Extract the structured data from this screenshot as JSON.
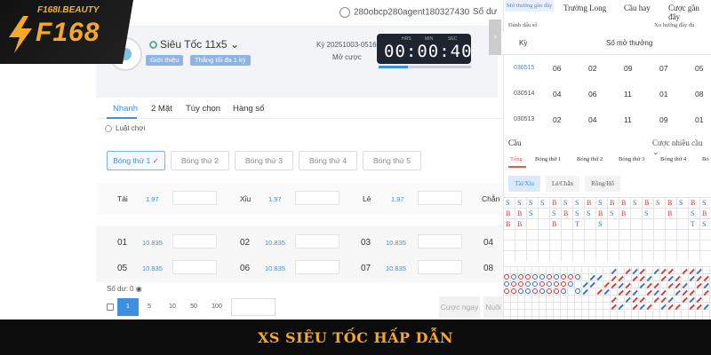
{
  "brand": {
    "domain": "F168I.BEAUTY",
    "name": "F168"
  },
  "header": {
    "account": "280obcp280agent180327430",
    "balance_label": "Số dư"
  },
  "game": {
    "title": "Siêu Tốc 11x5",
    "intro_label": "Giới thiệu",
    "limit_label": "Thắng tối đa 1 kỳ",
    "period": "Kỳ 20251003-0516",
    "status": "Mở cược",
    "timer_labels": [
      "HRS",
      "MIN",
      "SEC"
    ],
    "timer": "00:00:40",
    "timer_progress": 0.32
  },
  "main_tabs": [
    "Nhanh",
    "2 Mặt",
    "Tùy chọn",
    "Hàng số"
  ],
  "rules_link": "Luật chơi",
  "positions": [
    "Bóng thứ 1",
    "Bóng thứ 2",
    "Bóng thứ 3",
    "Bóng thứ 4",
    "Bóng thứ 5"
  ],
  "bets": [
    {
      "label": "Tài",
      "odd": "1.97"
    },
    {
      "label": "Xỉu",
      "odd": "1.97"
    },
    {
      "label": "Lẻ",
      "odd": "1.97"
    },
    {
      "label": "Chẵn",
      "odd": ""
    }
  ],
  "numbers": [
    {
      "num": "01",
      "odd": "10.835"
    },
    {
      "num": "02",
      "odd": "10.835"
    },
    {
      "num": "03",
      "odd": "10.835"
    },
    {
      "num": "04",
      "odd": ""
    },
    {
      "num": "05",
      "odd": "10.835"
    },
    {
      "num": "06",
      "odd": "10.835"
    },
    {
      "num": "07",
      "odd": "10.835"
    },
    {
      "num": "08",
      "odd": ""
    }
  ],
  "balance_row": {
    "label": "Số dư:",
    "value": "0"
  },
  "chips": [
    "1",
    "5",
    "10",
    "50",
    "100"
  ],
  "buttons": {
    "bet_now": "Cược ngay",
    "other": "Nuôi"
  },
  "right_tabs": [
    "Mở thưởng gần đây",
    "Trường Long",
    "Cầu hay",
    "Cược gần đây"
  ],
  "right_sub": {
    "left": "Đánh dấu số",
    "right": "Xu hướng đầy đủ"
  },
  "results_header": {
    "period": "Kỳ",
    "numbers": "Số mở thưởng"
  },
  "results": [
    {
      "period": "036515",
      "nums": [
        "06",
        "02",
        "09",
        "07",
        "05"
      ],
      "highlight": true
    },
    {
      "period": "030514",
      "nums": [
        "04",
        "06",
        "11",
        "01",
        "08"
      ],
      "highlight": false
    },
    {
      "period": "030513",
      "nums": [
        "02",
        "04",
        "11",
        "09",
        "01"
      ],
      "highlight": false
    }
  ],
  "cau": {
    "title": "Cầu",
    "more": "Cược nhiều cầu"
  },
  "cau_tabs": [
    "Tổng",
    "Bóng thứ 1",
    "Bóng thứ 2",
    "Bóng thứ 3",
    "Bóng thứ 4",
    "Bó"
  ],
  "cau_types": [
    "Tài/Xỉu",
    "Lẻ/Chẵn",
    "Rồng/Hổ"
  ],
  "road_cols": [
    [
      "S",
      "B",
      "B"
    ],
    [
      "S",
      "B",
      "B"
    ],
    [
      "S",
      "S",
      ""
    ],
    [
      "S",
      "",
      " "
    ],
    [
      "B",
      "S",
      "B"
    ],
    [
      "S",
      "B",
      ""
    ],
    [
      "S",
      "S",
      "T"
    ],
    [
      "B",
      "S",
      ""
    ],
    [
      "S",
      "B",
      "S"
    ],
    [
      "B",
      "S",
      ""
    ],
    [
      "B",
      "B",
      ""
    ],
    [
      "S",
      "",
      ""
    ],
    [
      "B",
      "S",
      ""
    ],
    [
      "S",
      "",
      ""
    ],
    [
      "B",
      "B",
      ""
    ],
    [
      "S",
      "",
      ""
    ],
    [
      "B",
      "S",
      "T"
    ],
    [
      "S",
      "B",
      "S"
    ]
  ],
  "colors": {
    "accent": "#3d8fe0",
    "brand": "#f6a928",
    "banner_bg": "#0c0c0c",
    "red": "#d03c3c"
  },
  "banner": "XS SIÊU TỐC HẤP DẪN"
}
